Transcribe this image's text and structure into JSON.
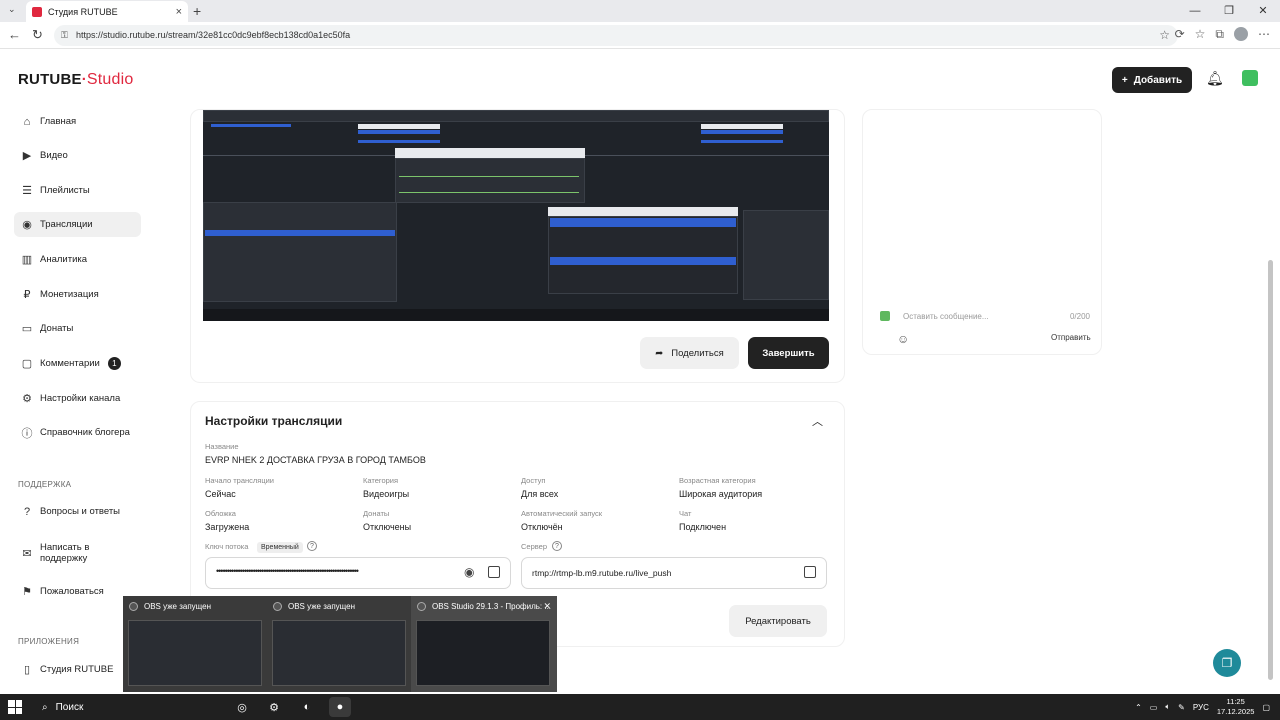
{
  "browser": {
    "tab_title": "Студия RUTUBE",
    "url": "https://studio.rutube.ru/stream/32e81cc0dc9ebf8ecb138cd0a1ec50fa"
  },
  "header": {
    "logo_main": "RUTUBE",
    "logo_studio": "Studio",
    "add_label": "Добавить"
  },
  "sidebar": {
    "items": [
      {
        "label": "Главная",
        "icon": "home-icon"
      },
      {
        "label": "Видео",
        "icon": "video-icon"
      },
      {
        "label": "Плейлисты",
        "icon": "playlist-icon"
      },
      {
        "label": "Трансляции",
        "icon": "broadcast-icon"
      },
      {
        "label": "Аналитика",
        "icon": "analytics-icon"
      },
      {
        "label": "Монетизация",
        "icon": "monetization-icon"
      },
      {
        "label": "Донаты",
        "icon": "donations-icon"
      },
      {
        "label": "Комментарии",
        "icon": "comments-icon",
        "badge": "1"
      },
      {
        "label": "Настройки канала",
        "icon": "settings-icon"
      },
      {
        "label": "Справочник блогера",
        "icon": "info-icon"
      }
    ],
    "support_heading": "ПОДДЕРЖКА",
    "support_items": [
      {
        "label": "Вопросы и ответы"
      },
      {
        "label": "Написать в поддержку"
      },
      {
        "label": "Пожаловаться"
      }
    ],
    "apps_heading": "ПРИЛОЖЕНИЯ",
    "apps_items": [
      {
        "label": "Студия RUTUBE"
      }
    ]
  },
  "preview": {
    "share_label": "Поделиться",
    "end_label": "Завершить"
  },
  "chat": {
    "placeholder": "Оставить сообщение...",
    "counter": "0/200",
    "send_label": "Отправить"
  },
  "settings": {
    "title": "Настройки трансляции",
    "name_label": "Название",
    "name_value": "EVRP NHEK 2 ДОСТАВКА ГРУЗА В ГОРОД ТАМБОВ",
    "fields": [
      {
        "label": "Начало трансляции",
        "value": "Сейчас"
      },
      {
        "label": "Категория",
        "value": "Видеоигры"
      },
      {
        "label": "Доступ",
        "value": "Для всех"
      },
      {
        "label": "Возрастная категория",
        "value": "Широкая аудитория"
      },
      {
        "label": "Обложка",
        "value": "Загружена"
      },
      {
        "label": "Донаты",
        "value": "Отключены"
      },
      {
        "label": "Автоматический запуск",
        "value": "Отключён"
      },
      {
        "label": "Чат",
        "value": "Подключен"
      }
    ],
    "key_label": "Ключ потока",
    "key_tag": "Временный",
    "key_value": "••••••••••••••••••••••••••••••••••••••••••••••••••••••••••••••••••",
    "server_label": "Сервер",
    "server_value": "rtmp://rtmp-lb.m9.rutube.ru/live_push",
    "edit_label": "Редактировать"
  },
  "thumbnails": [
    {
      "title": "OBS уже запущен"
    },
    {
      "title": "OBS уже запущен"
    },
    {
      "title": "OBS Studio 29.1.3 - Профиль: ..."
    }
  ],
  "taskbar": {
    "search_label": "Поиск",
    "lang": "РУС",
    "time": "11:25",
    "date": "17.12.2025"
  },
  "colors": {
    "brand_red": "#e0283f",
    "dark": "#222222",
    "help_fab": "#1f8a9a"
  }
}
